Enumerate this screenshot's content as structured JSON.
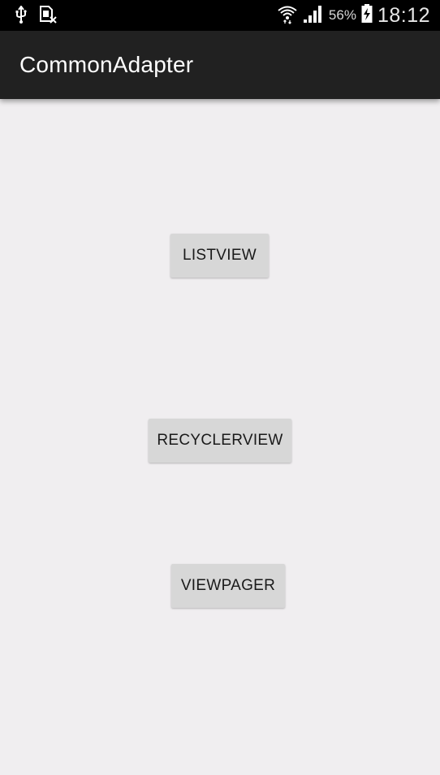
{
  "status_bar": {
    "icons_left": [
      "usb-icon",
      "sim-missing-icon"
    ],
    "icons_right": [
      "wifi-icon",
      "signal-icon",
      "battery-charging-icon"
    ],
    "battery_percent": "56%",
    "time": "18:12"
  },
  "app_bar": {
    "title": "CommonAdapter"
  },
  "buttons": {
    "listview": "LISTVIEW",
    "recyclerview": "RECYCLERVIEW",
    "viewpager": "VIEWPAGER"
  },
  "colors": {
    "status_bar_bg": "#000000",
    "app_bar_bg": "#212121",
    "content_bg": "#f0eef0",
    "button_bg": "#d7d7d7"
  }
}
